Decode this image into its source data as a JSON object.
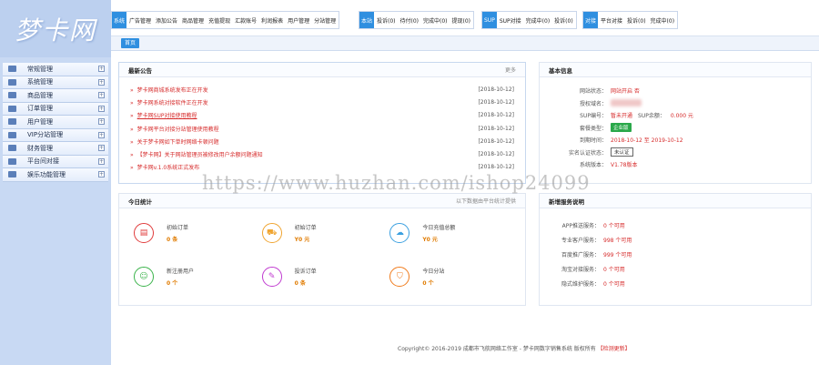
{
  "logo": "梦卡网",
  "nav": [
    {
      "label": "常规管理"
    },
    {
      "label": "系统管理"
    },
    {
      "label": "商品管理"
    },
    {
      "label": "订单管理"
    },
    {
      "label": "用户管理"
    },
    {
      "label": "VIP分站管理"
    },
    {
      "label": "财务管理"
    },
    {
      "label": "平台间对接"
    },
    {
      "label": "娱乐功能管理"
    }
  ],
  "topbar": {
    "groups": [
      {
        "title": "系统",
        "items": [
          "广告管理",
          "添加公告",
          "商品管理",
          "充值提现",
          "汇款账号",
          "利润报表",
          "用户管理",
          "分站管理"
        ]
      },
      {
        "title": "本站",
        "items": [
          "投诉(0)",
          "待付(0)",
          "完成中(0)",
          "提现(0)"
        ]
      },
      {
        "title": "SUP",
        "items": [
          "SUP对接",
          "完成中(0)",
          "投诉(0)"
        ]
      },
      {
        "title": "对接",
        "items": [
          "平台对接",
          "投诉(0)",
          "完成中(0)"
        ]
      }
    ],
    "home_tab": "首页"
  },
  "notice": {
    "title": "最新公告",
    "more": "更多",
    "items": [
      {
        "text": "梦卡网商城系统发布正在开发",
        "date": "[2018-10-12]"
      },
      {
        "text": "梦卡网系统对接软件正在开发",
        "date": "[2018-10-12]"
      },
      {
        "text": "梦卡网SUP对接使用教程",
        "date": "[2018-10-12]"
      },
      {
        "text": "梦卡网平台对接分站管理使用教程",
        "date": "[2018-10-12]"
      },
      {
        "text": "关于梦卡网如下单时网络卡顿问题",
        "date": "[2018-10-12]"
      },
      {
        "text": "【梦卡网】关于网站管理员被修改用户余额问题通知",
        "date": "[2018-10-12]"
      },
      {
        "text": "梦卡网v.1.0系统正式发布",
        "date": "[2018-10-12]"
      }
    ]
  },
  "basic": {
    "title": "基本信息",
    "rows": [
      {
        "label": "网站状态：",
        "value": "网站开启 否"
      },
      {
        "label": "授权域名：",
        "value": ""
      },
      {
        "label": "SUP编号：",
        "value": "暂未开通",
        "extra_label": "SUP余额：",
        "extra_value": "0.000 元"
      },
      {
        "label": "套餐类型：",
        "value": "企业版"
      },
      {
        "label": "到期时间：",
        "value": "2018-10-12 至 2019-10-12"
      },
      {
        "label": "实名认证状态：",
        "value": "未认证"
      },
      {
        "label": "系统版本：",
        "value": "V1.78版本"
      }
    ]
  },
  "stats": {
    "title": "今日统计",
    "more": "以下数据由平台统计提供",
    "items": [
      {
        "label": "初始订单",
        "value": "0 条",
        "icon": "clipboard-icon",
        "color": "#e03b3b"
      },
      {
        "label": "初始订单",
        "value": "Y0 元",
        "icon": "cart-icon",
        "color": "#f0a531"
      },
      {
        "label": "今日充值总额",
        "value": "Y0 元",
        "icon": "cloud-icon",
        "color": "#3ba0e0"
      },
      {
        "label": "新注册用户",
        "value": "0 个",
        "icon": "user-icon",
        "color": "#3ab34a"
      },
      {
        "label": "投诉订单",
        "value": "0 条",
        "icon": "edit-icon",
        "color": "#c03bd0"
      },
      {
        "label": "今日分站",
        "value": "0 个",
        "icon": "shield-icon",
        "color": "#f07b1b"
      }
    ]
  },
  "service": {
    "title": "新增服务说明",
    "rows": [
      {
        "label": "APP推送服务：",
        "value": "0 个可用"
      },
      {
        "label": "专业客户服务：",
        "value": "998 个可用"
      },
      {
        "label": "百度推广服务：",
        "value": "999 个可用"
      },
      {
        "label": "淘宝对接服务：",
        "value": "0 个可用"
      },
      {
        "label": "隐式维护服务：",
        "value": "0 个可用"
      }
    ]
  },
  "footer": {
    "text": "Copyright© 2016-2019 成都市飞航网络工作室 - 梦卡网数字销售系统 版权所有",
    "link": "【检测更新】"
  },
  "watermark": "https://www.huzhan.com/ishop24099"
}
